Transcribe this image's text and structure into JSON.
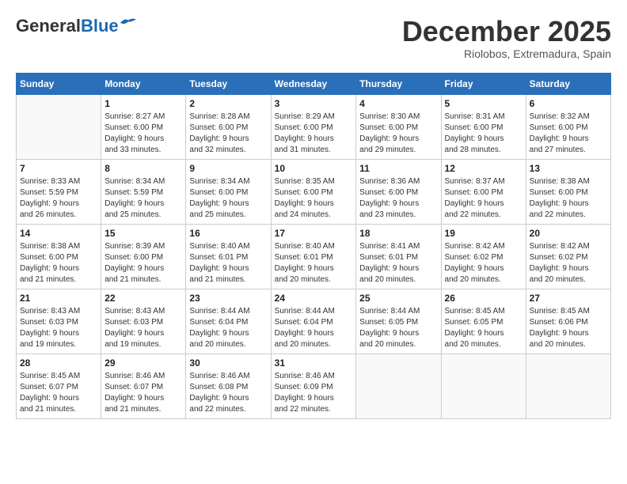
{
  "header": {
    "logo_general": "General",
    "logo_blue": "Blue",
    "month": "December 2025",
    "location": "Riolobos, Extremadura, Spain"
  },
  "days_of_week": [
    "Sunday",
    "Monday",
    "Tuesday",
    "Wednesday",
    "Thursday",
    "Friday",
    "Saturday"
  ],
  "weeks": [
    [
      {
        "day": "",
        "info": ""
      },
      {
        "day": "1",
        "info": "Sunrise: 8:27 AM\nSunset: 6:00 PM\nDaylight: 9 hours\nand 33 minutes."
      },
      {
        "day": "2",
        "info": "Sunrise: 8:28 AM\nSunset: 6:00 PM\nDaylight: 9 hours\nand 32 minutes."
      },
      {
        "day": "3",
        "info": "Sunrise: 8:29 AM\nSunset: 6:00 PM\nDaylight: 9 hours\nand 31 minutes."
      },
      {
        "day": "4",
        "info": "Sunrise: 8:30 AM\nSunset: 6:00 PM\nDaylight: 9 hours\nand 29 minutes."
      },
      {
        "day": "5",
        "info": "Sunrise: 8:31 AM\nSunset: 6:00 PM\nDaylight: 9 hours\nand 28 minutes."
      },
      {
        "day": "6",
        "info": "Sunrise: 8:32 AM\nSunset: 6:00 PM\nDaylight: 9 hours\nand 27 minutes."
      }
    ],
    [
      {
        "day": "7",
        "info": "Sunrise: 8:33 AM\nSunset: 5:59 PM\nDaylight: 9 hours\nand 26 minutes."
      },
      {
        "day": "8",
        "info": "Sunrise: 8:34 AM\nSunset: 5:59 PM\nDaylight: 9 hours\nand 25 minutes."
      },
      {
        "day": "9",
        "info": "Sunrise: 8:34 AM\nSunset: 6:00 PM\nDaylight: 9 hours\nand 25 minutes."
      },
      {
        "day": "10",
        "info": "Sunrise: 8:35 AM\nSunset: 6:00 PM\nDaylight: 9 hours\nand 24 minutes."
      },
      {
        "day": "11",
        "info": "Sunrise: 8:36 AM\nSunset: 6:00 PM\nDaylight: 9 hours\nand 23 minutes."
      },
      {
        "day": "12",
        "info": "Sunrise: 8:37 AM\nSunset: 6:00 PM\nDaylight: 9 hours\nand 22 minutes."
      },
      {
        "day": "13",
        "info": "Sunrise: 8:38 AM\nSunset: 6:00 PM\nDaylight: 9 hours\nand 22 minutes."
      }
    ],
    [
      {
        "day": "14",
        "info": "Sunrise: 8:38 AM\nSunset: 6:00 PM\nDaylight: 9 hours\nand 21 minutes."
      },
      {
        "day": "15",
        "info": "Sunrise: 8:39 AM\nSunset: 6:00 PM\nDaylight: 9 hours\nand 21 minutes."
      },
      {
        "day": "16",
        "info": "Sunrise: 8:40 AM\nSunset: 6:01 PM\nDaylight: 9 hours\nand 21 minutes."
      },
      {
        "day": "17",
        "info": "Sunrise: 8:40 AM\nSunset: 6:01 PM\nDaylight: 9 hours\nand 20 minutes."
      },
      {
        "day": "18",
        "info": "Sunrise: 8:41 AM\nSunset: 6:01 PM\nDaylight: 9 hours\nand 20 minutes."
      },
      {
        "day": "19",
        "info": "Sunrise: 8:42 AM\nSunset: 6:02 PM\nDaylight: 9 hours\nand 20 minutes."
      },
      {
        "day": "20",
        "info": "Sunrise: 8:42 AM\nSunset: 6:02 PM\nDaylight: 9 hours\nand 20 minutes."
      }
    ],
    [
      {
        "day": "21",
        "info": "Sunrise: 8:43 AM\nSunset: 6:03 PM\nDaylight: 9 hours\nand 19 minutes."
      },
      {
        "day": "22",
        "info": "Sunrise: 8:43 AM\nSunset: 6:03 PM\nDaylight: 9 hours\nand 19 minutes."
      },
      {
        "day": "23",
        "info": "Sunrise: 8:44 AM\nSunset: 6:04 PM\nDaylight: 9 hours\nand 20 minutes."
      },
      {
        "day": "24",
        "info": "Sunrise: 8:44 AM\nSunset: 6:04 PM\nDaylight: 9 hours\nand 20 minutes."
      },
      {
        "day": "25",
        "info": "Sunrise: 8:44 AM\nSunset: 6:05 PM\nDaylight: 9 hours\nand 20 minutes."
      },
      {
        "day": "26",
        "info": "Sunrise: 8:45 AM\nSunset: 6:05 PM\nDaylight: 9 hours\nand 20 minutes."
      },
      {
        "day": "27",
        "info": "Sunrise: 8:45 AM\nSunset: 6:06 PM\nDaylight: 9 hours\nand 20 minutes."
      }
    ],
    [
      {
        "day": "28",
        "info": "Sunrise: 8:45 AM\nSunset: 6:07 PM\nDaylight: 9 hours\nand 21 minutes."
      },
      {
        "day": "29",
        "info": "Sunrise: 8:46 AM\nSunset: 6:07 PM\nDaylight: 9 hours\nand 21 minutes."
      },
      {
        "day": "30",
        "info": "Sunrise: 8:46 AM\nSunset: 6:08 PM\nDaylight: 9 hours\nand 22 minutes."
      },
      {
        "day": "31",
        "info": "Sunrise: 8:46 AM\nSunset: 6:09 PM\nDaylight: 9 hours\nand 22 minutes."
      },
      {
        "day": "",
        "info": ""
      },
      {
        "day": "",
        "info": ""
      },
      {
        "day": "",
        "info": ""
      }
    ]
  ]
}
